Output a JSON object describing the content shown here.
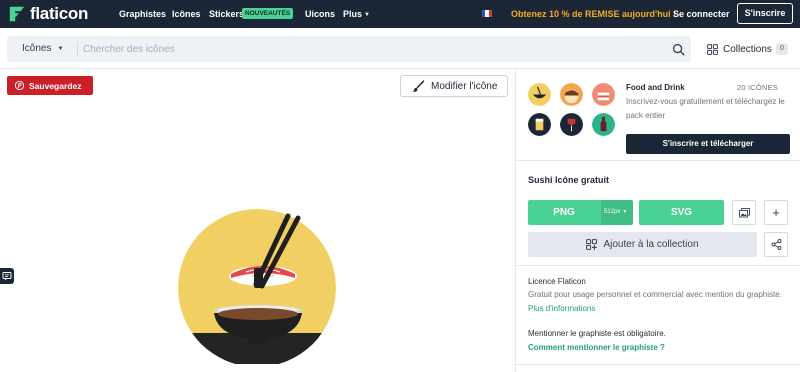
{
  "nav": {
    "brand": "flaticon",
    "links": [
      "Graphistes",
      "Icônes",
      "Stickers",
      "Uicons",
      "Plus"
    ],
    "new_badge": "NOUVEAUTÉS",
    "promo": "Obtenez 10 % de REMISE aujourd'hui !",
    "login": "Se connecter",
    "signup": "S'inscrire",
    "colors": {
      "bg": "#1b2637",
      "accent": "#4ad295",
      "promo": "#f6ab1b"
    }
  },
  "search": {
    "category": "Icônes",
    "placeholder": "Chercher des icônes",
    "collections_label": "Collections",
    "collections_count": "0"
  },
  "left": {
    "save_label": "Sauvegardez",
    "edit_label": "Modifier l'icône"
  },
  "pack": {
    "title": "Food and Drink",
    "count": "20 ICÔNES",
    "description": "Inscrivez-vous gratuitement et téléchargez le pack entier",
    "download_label": "S'inscrire et télécharger"
  },
  "icon": {
    "title": "Sushi Icône gratuit",
    "png_label": "PNG",
    "png_size": "512px",
    "svg_label": "SVG",
    "collection_label": "Ajouter à la collection"
  },
  "license": {
    "title": "Licence Flaticon",
    "description": "Gratuit pour usage personnel et commercial avec mention du graphiste.",
    "more_link": "Plus d'informations",
    "attribution_title": "Mentionner le graphiste est obligatoire.",
    "attribution_link": "Comment mentionner le graphiste ?"
  }
}
